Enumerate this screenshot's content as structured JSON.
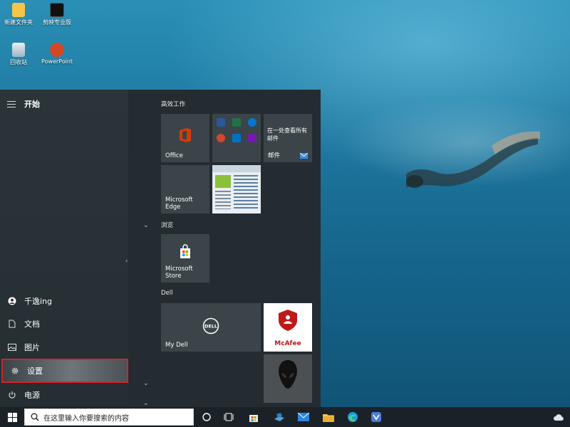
{
  "desktop": {
    "icons": [
      {
        "label": "新建文件夹",
        "icon": "folder-icon"
      },
      {
        "label": "剪映专业版",
        "icon": "jianying-icon"
      },
      {
        "label": "回收站",
        "icon": "recycle-bin-icon"
      },
      {
        "label": "PowerPoint",
        "icon": "powerpoint-icon"
      }
    ]
  },
  "start_menu": {
    "title": "开始",
    "left_items": [
      {
        "label": "千逸ing",
        "icon": "user-icon"
      },
      {
        "label": "文档",
        "icon": "document-icon"
      },
      {
        "label": "图片",
        "icon": "pictures-icon"
      },
      {
        "label": "设置",
        "icon": "gear-icon"
      },
      {
        "label": "电源",
        "icon": "power-icon"
      }
    ],
    "groups": [
      {
        "label": "高效工作"
      },
      {
        "label": "浏览"
      },
      {
        "label": "Dell"
      }
    ],
    "tiles": {
      "office": "Office",
      "mail_text": "在一处查看所有邮件",
      "mail": "邮件",
      "edge": "Microsoft Edge",
      "store": "Microsoft Store",
      "mydell": "My Dell",
      "mcafee": "McAfee"
    }
  },
  "taskbar": {
    "search_placeholder": "在这里输入你要搜索的内容",
    "icons": [
      "windows-start-icon",
      "search-icon",
      "cortana-icon",
      "task-view-icon",
      "store-icon",
      "fileexplorer-icon",
      "mail-icon",
      "folder-icon",
      "edge-icon",
      "app-icon",
      "weather-icon"
    ]
  },
  "colors": {
    "menu_bg": "#242c32",
    "tile_bg": "#3b4449",
    "highlight_border": "#d9222a",
    "office_red": "#d83b01",
    "mcafee_red": "#c01818"
  }
}
